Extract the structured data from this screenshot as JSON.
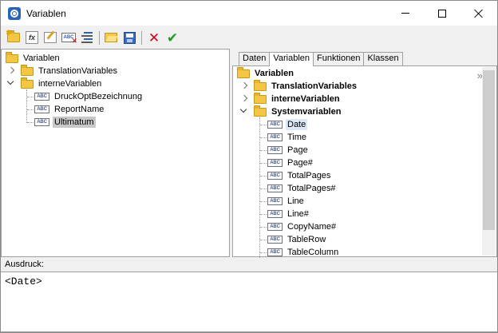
{
  "window": {
    "title": "Variablen"
  },
  "toolbar": {
    "buttons": [
      {
        "icon": "new-folder-icon"
      },
      {
        "icon": "new-formula-icon"
      },
      {
        "icon": "edit-icon"
      },
      {
        "icon": "delete-variable-icon"
      },
      {
        "icon": "list-icon"
      },
      {
        "icon": "open-icon"
      },
      {
        "icon": "save-icon"
      },
      {
        "icon": "cancel-icon"
      },
      {
        "icon": "ok-icon"
      }
    ]
  },
  "left_tree": {
    "root": "Variablen",
    "items": [
      {
        "label": "TranslationVariables",
        "type": "folder",
        "state": "collapsed"
      },
      {
        "label": "interneVariablen",
        "type": "folder",
        "state": "expanded"
      },
      {
        "label": "DruckOptBezeichnung",
        "type": "variable"
      },
      {
        "label": "ReportName",
        "type": "variable"
      },
      {
        "label": "Ultimatum",
        "type": "variable",
        "selected": true
      }
    ]
  },
  "right_panel": {
    "tabs": [
      "Daten",
      "Variablen",
      "Funktionen",
      "Klassen"
    ],
    "active_tab": "Variablen",
    "root": "Variablen",
    "folders": [
      "TranslationVariables",
      "interneVariablen",
      "Systemvariablen"
    ],
    "system_variables": [
      "Date",
      "Time",
      "Page",
      "Page#",
      "TotalPages",
      "TotalPages#",
      "Line",
      "Line#",
      "CopyName#",
      "TableRow",
      "TableColumn"
    ],
    "selected": "Date"
  },
  "expression": {
    "label": "Ausdruck:",
    "value": "<Date>"
  },
  "abc_glyph": "ABC",
  "colors": {
    "accent": "#2b63b6",
    "folder": "#f3c744",
    "cancel": "#d0021b",
    "ok": "#1f9a2a"
  }
}
